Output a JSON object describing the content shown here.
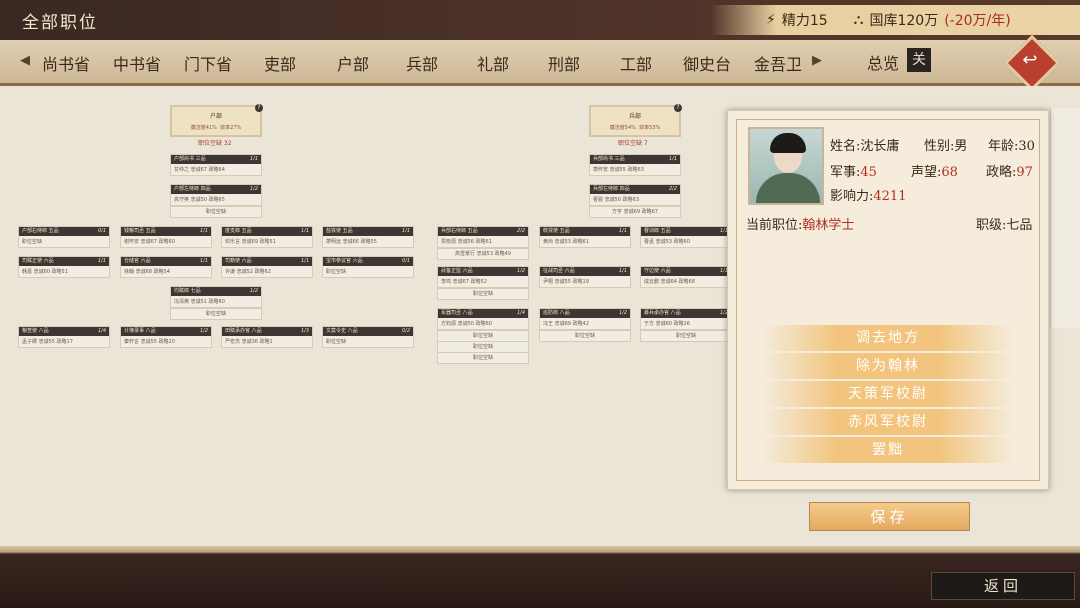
{
  "header": {
    "title": "全部职位",
    "energy": "精力15",
    "treasury": "国库120万",
    "treasury_delta": "(-20万/年)"
  },
  "tabs": [
    "尚书省",
    "中书省",
    "门下省",
    "吏部",
    "户部",
    "兵部",
    "礼部",
    "刑部",
    "工部",
    "御史台",
    "金吾卫"
  ],
  "overview_label": "总览",
  "close_icon_text": "关",
  "tree_left": {
    "root": {
      "title": "户部",
      "stat_a": "廉洁度41%",
      "stat_b": "效率27%",
      "vacancies": "职位空缺 32"
    },
    "nodes": [
      {
        "h": "户部尚书 三品",
        "c": "1/1",
        "b": "甘仲之  忠诚67 政略64"
      },
      {
        "h": "户部左侍郎 四品",
        "c": "1/2",
        "b": "高守英  忠诚50 政略65"
      },
      {
        "h": "",
        "c": "",
        "b": "职位空缺"
      },
      {
        "h": "户部右侍郎 五品",
        "c": "0/1",
        "b": "职位空缺"
      },
      {
        "h": "钱粮司丞 五品",
        "c": "1/1",
        "b": "谢怀安  忠诚67 政略60"
      },
      {
        "h": "度支郎 五品",
        "c": "1/1",
        "b": "邓乐言  忠诚69 政略51"
      },
      {
        "h": "盐铁使 五品",
        "c": "1/1",
        "b": "萧明远  忠诚66 政略55"
      },
      {
        "h": "司赋正使 六品",
        "c": "1/1",
        "b": "韩嘉  忠诚60 政略51"
      },
      {
        "h": "仓储官 六品",
        "c": "1/1",
        "b": "徐翰  忠诚68 政略54"
      },
      {
        "h": "司籍使 六品",
        "c": "1/1",
        "b": "许谦  忠诚52 政略62"
      },
      {
        "h": "宝市参议官 六品",
        "c": "0/1",
        "b": "职位空缺"
      },
      {
        "h": "均赋郎 七品",
        "c": "1/2",
        "b": "冯清英  忠诚51 政略60"
      },
      {
        "h": "",
        "c": "",
        "b": "职位空缺"
      },
      {
        "h": "粮查使 八品",
        "c": "1/4",
        "b": "孟子卿  忠诚55 政略17"
      },
      {
        "h": "计簿录事 八品",
        "c": "1/2",
        "b": "秦轩言  忠诚55 政略20"
      },
      {
        "h": "田赋承办官 八品",
        "c": "1/3",
        "b": "严宏杰  忠诚36 政略1"
      },
      {
        "h": "文案令史 八品",
        "c": "0/2",
        "b": "职位空缺"
      }
    ]
  },
  "tree_right": {
    "root": {
      "title": "兵部",
      "stat_a": "廉洁度54%",
      "stat_b": "效率53%",
      "vacancies": "职位空缺 7"
    },
    "nodes": [
      {
        "h": "兵部尚书 三品",
        "c": "1/1",
        "b": "萧怀安  忠诚55 政略63"
      },
      {
        "h": "兵部左侍郎 四品",
        "c": "2/2",
        "b": "曹骏  忠诚50 政略63"
      },
      {
        "h": "",
        "c": "",
        "b": "方宇  忠诚69 政略67"
      },
      {
        "h": "兵部右侍郎 五品",
        "c": "2/2",
        "b": "贾晓源  忠诚56 政略61"
      },
      {
        "h": "",
        "c": "",
        "b": "高雪景行  忠诚53 政略49"
      },
      {
        "h": "统戎使 五品",
        "c": "1/1",
        "b": "黄尚  忠诚53 政略61"
      },
      {
        "h": "督训郎 五品",
        "c": "1/1",
        "b": "曹孟  忠诚53 政略60"
      },
      {
        "h": "武备正监 六品",
        "c": "1/2",
        "b": "李鸣  忠诚67 政略52"
      },
      {
        "h": "",
        "c": "",
        "b": "职位空缺"
      },
      {
        "h": "征战司丞 六品",
        "c": "1/1",
        "b": "尹桐  忠诚55 政略19"
      },
      {
        "h": "守边使 六品",
        "c": "1/1",
        "b": "成云鹏  忠诚64 政略68"
      },
      {
        "h": "军器司丞 八品",
        "c": "1/4",
        "b": "方钧源  忠诚50 政略60"
      },
      {
        "h": "",
        "c": "",
        "b": "职位空缺"
      },
      {
        "h": "",
        "c": "",
        "b": "职位空缺"
      },
      {
        "h": "",
        "c": "",
        "b": "职位空缺"
      },
      {
        "h": "巡防郎 八品",
        "c": "1/2",
        "b": "冯王  忠诚69 政略42"
      },
      {
        "h": "",
        "c": "",
        "b": "职位空缺"
      },
      {
        "h": "募兵承办官 八品",
        "c": "1/2",
        "b": "于方  忠诚60 政略26"
      },
      {
        "h": "",
        "c": "",
        "b": "职位空缺"
      }
    ]
  },
  "character": {
    "name_label": "姓名:",
    "name": "沈长庸",
    "gender_label": "性别:",
    "gender": "男",
    "age_label": "年龄:",
    "age": "30",
    "military_label": "军事:",
    "military": "45",
    "prestige_label": "声望:",
    "prestige": "68",
    "politics_label": "政略:",
    "politics": "97",
    "influence_label": "影响力:",
    "influence": "4211",
    "position_label": "当前职位:",
    "position": "翰林学士",
    "rank_label": "职级:",
    "rank": "七品"
  },
  "actions": [
    "调去地方",
    "除为翰林",
    "天策军校尉",
    "赤风军校尉",
    "罢黜"
  ],
  "save_label": "保存",
  "return_label": "返回",
  "colors": {
    "accent": "#b03020",
    "button": "#f2c47e",
    "dark": "#3e3633"
  }
}
